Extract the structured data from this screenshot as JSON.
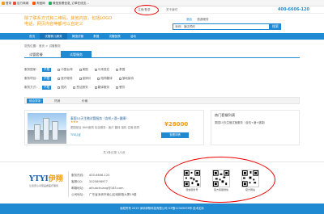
{
  "favbar": {
    "items": [
      "登录",
      "百万商城",
      "淘宝网",
      "微信查看信息_订单在线支..."
    ]
  },
  "topbar": {
    "links": [
      "注册/登录",
      "关于我们"
    ],
    "hotline": "400-6606-120"
  },
  "header": {
    "slogan_line1": "除了联系方式和二维码，其他内容，包括LOGO",
    "slogan_line2": "电话，网页内容等都可以自定义",
    "search_tabs": [
      "酒店",
      "旅游服务"
    ],
    "search_value": "深圳｜酒店预约",
    "search_button": "搜索"
  },
  "nav": {
    "items": [
      "首页",
      "试管婴儿服务",
      "美国试管",
      "泰国",
      "试管医院",
      "活动"
    ]
  },
  "breadcrumb": "您的位置：首页 > 试管服务",
  "tabs": {
    "tab1": "试管套餐",
    "tab2": "试管服务"
  },
  "filters": {
    "rows": [
      {
        "label": "服务国家：",
        "options": [
          "不限",
          "中国台湾",
          "美国",
          "马来西亚",
          "泰国"
        ],
        "selected": 0
      },
      {
        "label": "服务项目：",
        "options": [
          "不限",
          "医疗服务",
          "促卵仪",
          "陪同翻译",
          "落地接待"
        ],
        "selected": 0
      },
      {
        "label": "服务方式：",
        "options": [
          "不限",
          "国内",
          "签证服务",
          "翻译服务",
          "餐饮"
        ],
        "selected": 0
      }
    ]
  },
  "sortbar": {
    "items": [
      "综合排序",
      "热销",
      "价格"
    ]
  },
  "listing": {
    "title": "泰国10天生殖试管服务（含机+酒+健康）",
    "stars": "★★★",
    "address": "泰国曼谷 BNH医院 包含服务：医疗 翻译 接机 住宿 陪同",
    "tag": "TFA认证",
    "price": "¥28000",
    "button": "查看详情"
  },
  "hot": {
    "title": "热门套餐列表",
    "line": "泰国10天生殖试管服务（含机+酒+健康）"
  },
  "pager": "共1条记录 1/1页",
  "footer": {
    "logo_main": "YTYI",
    "logo_cn": "伊翔",
    "slogan": "让您安心享受品质医疗服务",
    "rows": [
      {
        "k": "服务热线：",
        "v": "400-6606-120"
      },
      {
        "k": "客服QQ：",
        "v": "2025898977"
      },
      {
        "k": "邮箱地址：",
        "v": "aihuachuang@163.com"
      },
      {
        "k": "公司地址：",
        "v": "广东省深圳市南山区南新路大厦19楼"
      }
    ],
    "qrs": [
      "微信服务号",
      "官方客服微信",
      "官方网站"
    ]
  },
  "bottombar": "版权所有 2019 深圳伊翔科技有限公司 ICP备12345678号 技术支持"
}
